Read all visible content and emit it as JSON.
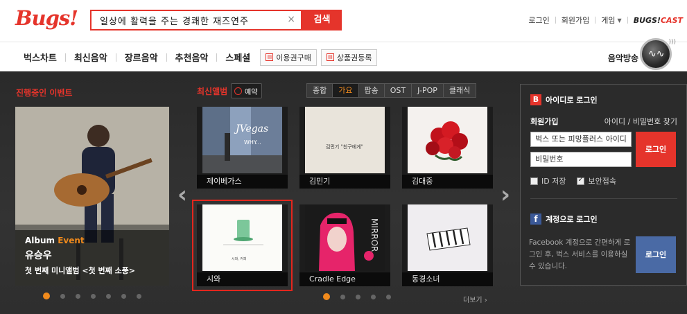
{
  "header": {
    "logo": "Bugs!",
    "search_value": "일상에 활력을 주는 경쾌한 재즈연주",
    "search_button": "검색",
    "clear_icon": "×",
    "links": [
      "로그인",
      "회원가입",
      "게임"
    ],
    "bugscast_a": "BUGS!",
    "bugscast_b": "CAST"
  },
  "nav": {
    "items": [
      "벅스차트",
      "최신음악",
      "장르음악",
      "추천음악",
      "스페셜"
    ],
    "button_purchase": "이용권구매",
    "button_coupon": "상품권등록",
    "radio": "음악방송"
  },
  "events": {
    "title": "진행중인 이벤트",
    "tag_album": "Album",
    "tag_event": "Event",
    "artist": "유승우",
    "description": "첫 번째 미니앨범 <첫 번째 소풍>",
    "dots_total": 7,
    "active_dot": 1
  },
  "albums": {
    "title": "최신앨범",
    "reserve": "예약",
    "tabs": [
      "종합",
      "가요",
      "팝송",
      "OST",
      "J-POP",
      "클래식"
    ],
    "active_tab": "가요",
    "items": [
      {
        "name": "제이베가스",
        "cover_text": "JVegas",
        "cover_sub": "WHY..."
      },
      {
        "name": "김민기",
        "cover_text": "김민기 \"친구에게\""
      },
      {
        "name": "김대중"
      },
      {
        "name": "시와",
        "cover_text": "시와, 커피"
      },
      {
        "name": "Cradle Edge",
        "cover_text": "MIRROR"
      },
      {
        "name": "동경소녀"
      }
    ],
    "more": "더보기 ›",
    "dots_total": 5,
    "active_dot": 1
  },
  "login": {
    "title": "아이디로 로그인",
    "join": "회원가입",
    "find": "아이디 / 비밀번호 찾기",
    "id_placeholder": "벅스 또는 피망플러스 아이디",
    "pw_placeholder": "비밀번호",
    "login_button": "로그인",
    "save_id": "ID 저장",
    "secure": "보안접속",
    "fb_title": "계정으로 로그인",
    "fb_desc": "Facebook 계정으로 간편하게 로그인 후, 벅스 서비스를 이용하실 수 있습니다.",
    "fb_button": "로그인"
  }
}
